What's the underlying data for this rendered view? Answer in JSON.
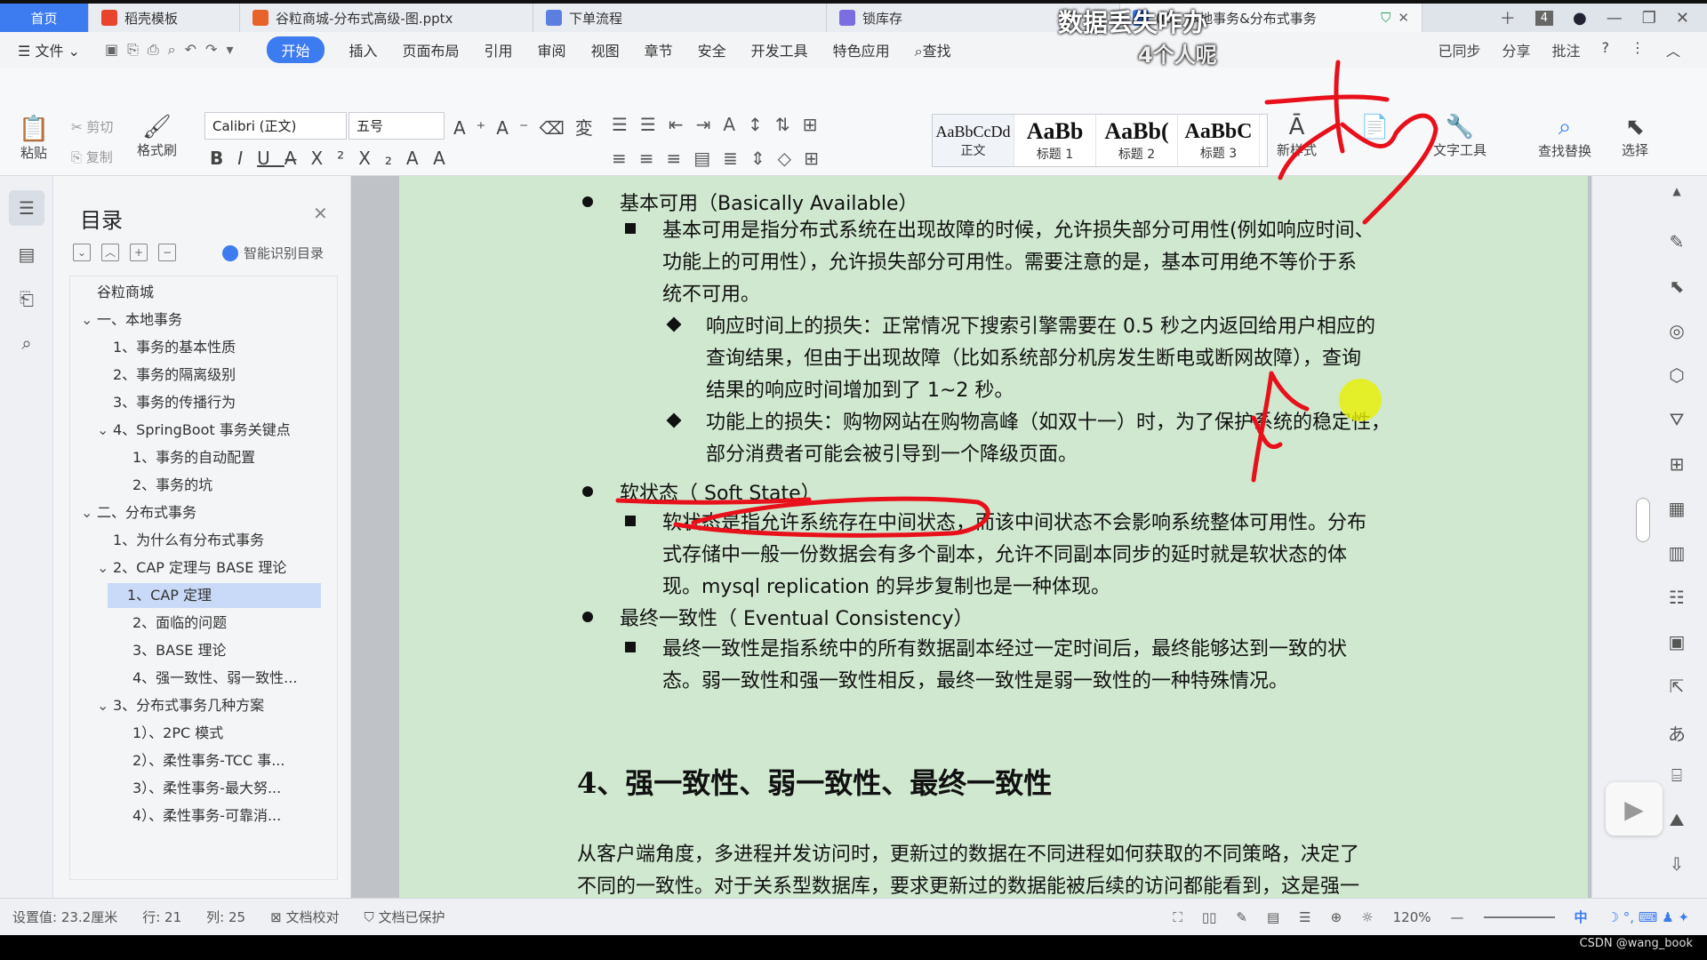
{
  "tabs": [
    {
      "label": "首页",
      "kind": "home"
    },
    {
      "label": "稻壳模板",
      "color": "#e8452c"
    },
    {
      "label": "谷粒商城-分布式高级-图.pptx",
      "color": "#e8632c"
    },
    {
      "label": "下单流程",
      "color": "#5b7fe0"
    },
    {
      "label": "锁库存",
      "color": "#7a6ee0"
    },
    {
      "label": "03、本地事务&分布式事务",
      "color": "#3d7bf0"
    }
  ],
  "tab_count": "4",
  "menu": {
    "file": "文件",
    "items": [
      "开始",
      "插入",
      "页面布局",
      "引用",
      "审阅",
      "视图",
      "章节",
      "安全",
      "开发工具",
      "特色应用"
    ],
    "search": "查找",
    "right": [
      "已同步",
      "分享",
      "批注"
    ]
  },
  "ribbon": {
    "paste": "粘贴",
    "cut": "剪切",
    "copy": "复制",
    "format_painter": "格式刷",
    "font_name": "Calibri (正文)",
    "font_size": "五号",
    "new_style": "新样式",
    "text_tools": "文字工具",
    "find_replace": "查找替换",
    "select": "选择",
    "styles": [
      {
        "preview": "AaBbCcDd",
        "name": "正文"
      },
      {
        "preview": "AaBb",
        "name": "标题 1"
      },
      {
        "preview": "AaBb(",
        "name": "标题 2"
      },
      {
        "preview": "AaBbC",
        "name": "标题 3"
      }
    ]
  },
  "toc": {
    "title": "目录",
    "smart": "智能识别目录",
    "items": [
      {
        "text": "谷粒商城",
        "level": 0,
        "chev": ""
      },
      {
        "text": "一、本地事务",
        "level": 0,
        "chev": "v"
      },
      {
        "text": "1、事务的基本性质",
        "level": 1,
        "chev": ""
      },
      {
        "text": "2、事务的隔离级别",
        "level": 1,
        "chev": ""
      },
      {
        "text": "3、事务的传播行为",
        "level": 1,
        "chev": ""
      },
      {
        "text": "4、SpringBoot 事务关键点",
        "level": 1,
        "chev": "v"
      },
      {
        "text": "1、事务的自动配置",
        "level": 2,
        "chev": ""
      },
      {
        "text": "2、事务的坑",
        "level": 2,
        "chev": ""
      },
      {
        "text": "二、分布式事务",
        "level": 0,
        "chev": "v"
      },
      {
        "text": "1、为什么有分布式事务",
        "level": 1,
        "chev": ""
      },
      {
        "text": "2、CAP 定理与 BASE 理论",
        "level": 1,
        "chev": "v"
      },
      {
        "text": "1、CAP 定理",
        "level": 2,
        "chev": "",
        "selected": true
      },
      {
        "text": "2、面临的问题",
        "level": 2,
        "chev": ""
      },
      {
        "text": "3、BASE 理论",
        "level": 2,
        "chev": ""
      },
      {
        "text": "4、强一致性、弱一致性...",
        "level": 2,
        "chev": ""
      },
      {
        "text": "3、分布式事务几种方案",
        "level": 1,
        "chev": "v"
      },
      {
        "text": "1）、2PC 模式",
        "level": 2,
        "chev": ""
      },
      {
        "text": "2）、柔性事务-TCC 事...",
        "level": 2,
        "chev": ""
      },
      {
        "text": "3）、柔性事务-最大努...",
        "level": 2,
        "chev": ""
      },
      {
        "text": "4）、柔性事务-可靠消...",
        "level": 2,
        "chev": ""
      }
    ]
  },
  "doc": {
    "lines": [
      "基本可用（Basically Available）",
      "基本可用是指分布式系统在出现故障的时候，允许损失部分可用性(例如响应时间、",
      "功能上的可用性），允许损失部分可用性。需要注意的是，基本可用绝不等价于系",
      "统不可用。",
      "响应时间上的损失：正常情况下搜索引擎需要在 0.5 秒之内返回给用户相应的",
      "查询结果，但由于出现故障（比如系统部分机房发生断电或断网故障），查询",
      "结果的响应时间增加到了 1~2 秒。",
      "功能上的损失：购物网站在购物高峰（如双十一）时，为了保护系统的稳定性，",
      "部分消费者可能会被引导到一个降级页面。",
      "软状态（ Soft State）",
      "软状态是指允许系统存在中间状态，而该中间状态不会影响系统整体可用性。分布",
      "式存储中一般一份数据会有多个副本，允许不同副本同步的延时就是软状态的体",
      "现。mysql replication 的异步复制也是一种体现。",
      "最终一致性（ Eventual Consistency）",
      "最终一致性是指系统中的所有数据副本经过一定时间后，最终能够达到一致的状",
      "态。弱一致性和强一致性相反，最终一致性是弱一致性的一种特殊情况。"
    ],
    "heading": "4、强一致性、弱一致性、最终一致性",
    "para": [
      "从客户端角度，多进程并发访问时，更新过的数据在不同进程如何获取的不同策略，决定了",
      "不同的一致性。对于关系型数据库，要求更新过的数据能被后续的访问都能看到，这是强一"
    ]
  },
  "status": {
    "setting": "设置值: 23.2厘米",
    "row": "行: 21",
    "col": "列: 25",
    "proof": "文档校对",
    "protected": "文档已保护",
    "zoom": "120%",
    "ime": "中"
  },
  "overlay": {
    "top1": "数据丢失咋办",
    "top2": "4个人呢"
  },
  "watermark": "CSDN @wang_book"
}
